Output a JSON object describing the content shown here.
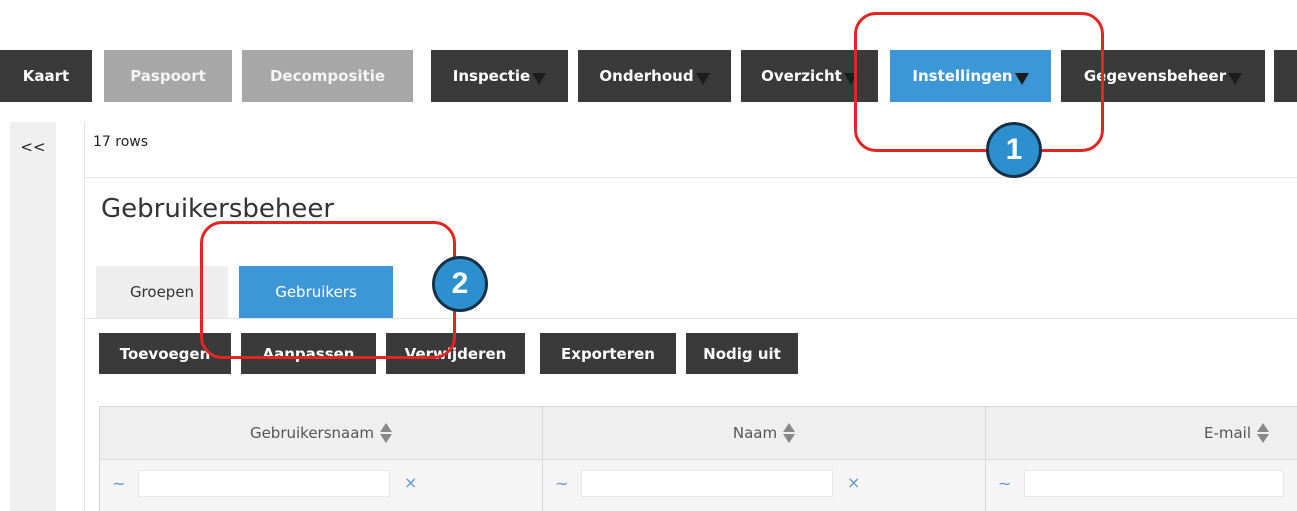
{
  "topnav": {
    "items": [
      {
        "label": "Kaart",
        "state": "normal"
      },
      {
        "label": "Paspoort",
        "state": "disabled"
      },
      {
        "label": "Decompositie",
        "state": "disabled"
      },
      {
        "label": "Inspectie",
        "state": "normal",
        "dropdown": true
      },
      {
        "label": "Onderhoud",
        "state": "normal",
        "dropdown": true
      },
      {
        "label": "Overzicht",
        "state": "normal",
        "dropdown": true
      },
      {
        "label": "Instellingen",
        "state": "active",
        "dropdown": true
      },
      {
        "label": "Gegevensbeheer",
        "state": "normal",
        "dropdown": true
      }
    ]
  },
  "sidebar": {
    "collapse_label": "<<"
  },
  "content": {
    "rows_count": "17 rows",
    "title": "Gebruikersbeheer",
    "tabs": [
      {
        "label": "Groepen",
        "active": false
      },
      {
        "label": "Gebruikers",
        "active": true
      }
    ],
    "actions": [
      "Toevoegen",
      "Aanpassen",
      "Verwijderen",
      "Exporteren",
      "Nodig uit"
    ]
  },
  "table": {
    "columns": [
      "Gebruikersnaam",
      "Naam",
      "E-mail"
    ],
    "filter_operator": "~",
    "filter_clear": "×",
    "filter_value": ""
  },
  "annotations": {
    "step1": "1",
    "step2": "2"
  },
  "colors": {
    "nav_dark": "#3a3a3a",
    "nav_disabled": "#a7a7a7",
    "accent_blue": "#3d97d6",
    "highlight_red": "#e52521",
    "badge_blue": "#2c8fce"
  }
}
